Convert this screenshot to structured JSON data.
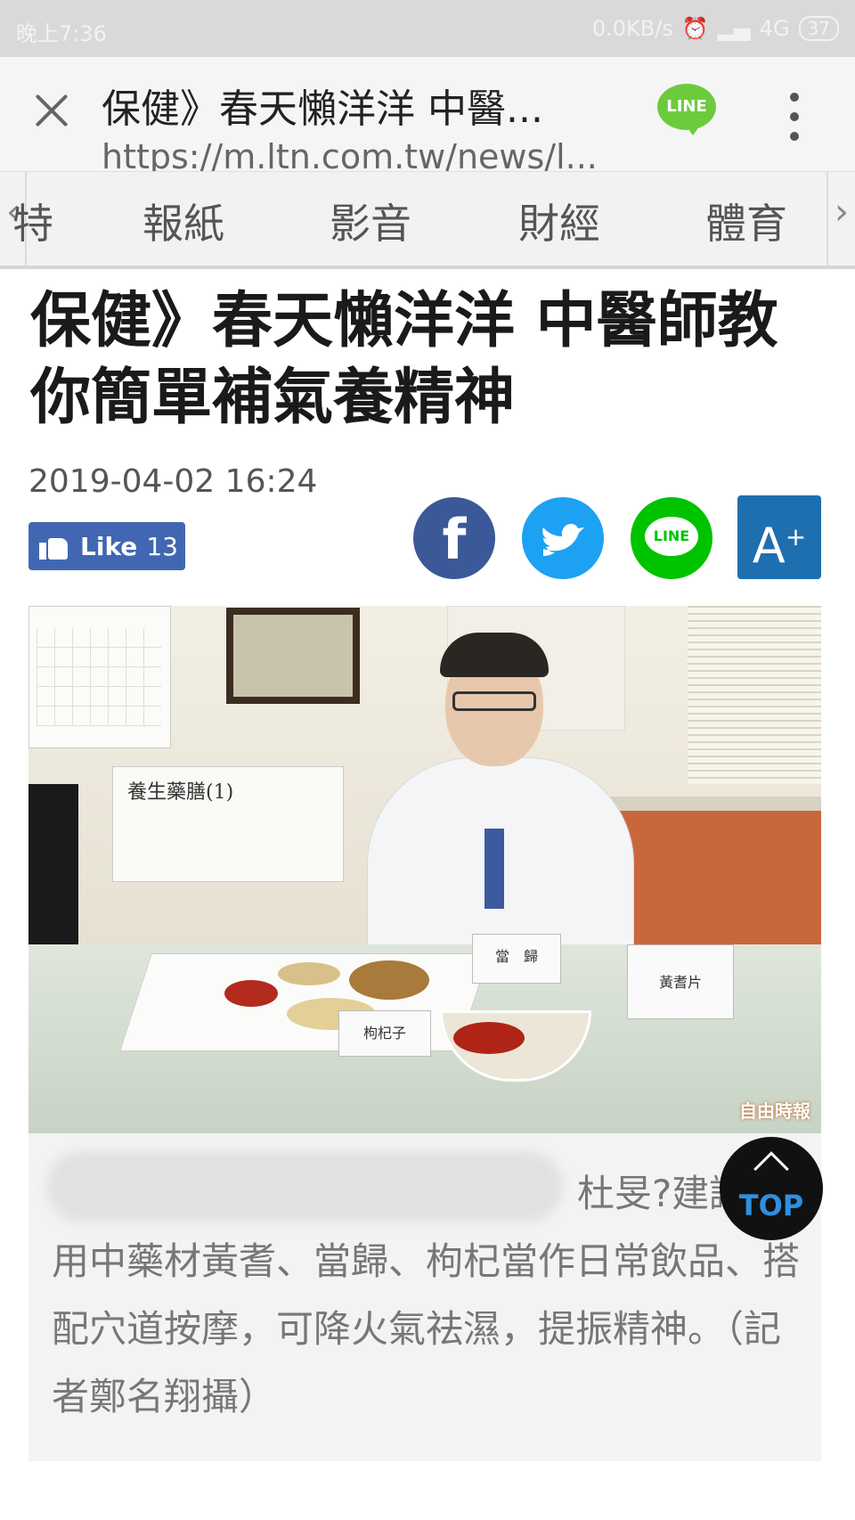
{
  "status_bar": {
    "time": "晚上7:36",
    "network_speed": "0.0KB/s",
    "network_type": "4G",
    "battery": "37"
  },
  "browser": {
    "title": "保健》春天懶洋洋 中醫...",
    "url": "https://m.ltn.com.tw/news/l...",
    "line_label": "LINE"
  },
  "categories": {
    "items": [
      "特",
      "報紙",
      "影音",
      "財經",
      "體育"
    ]
  },
  "article": {
    "headline": "保健》春天懶洋洋 中醫師教你簡單補氣養精神",
    "date": "2019-04-02 16:24",
    "like_label": "Like",
    "like_count": "13"
  },
  "share": {
    "facebook_glyph": "f",
    "line_label": "LINE",
    "font_size_label": "A"
  },
  "photo": {
    "poster_title": "養生藥膳(1)",
    "label_goji": "枸杞子",
    "label_danggui": "當　歸",
    "label_huangqi": "黃耆片",
    "watermark": "自由時報"
  },
  "caption": {
    "text": "杜旻?建議可用中藥材黃耆、當歸、枸杞當作日常飲品、搭配穴道按摩，可降火氣祛濕，提振精神。（記者鄭名翔攝）"
  },
  "top_button": {
    "label": "TOP"
  },
  "colors": {
    "facebook": "#3b5998",
    "twitter": "#1da1f2",
    "line": "#00c300",
    "font_button": "#1e6fb0",
    "like_button": "#4267b2"
  }
}
